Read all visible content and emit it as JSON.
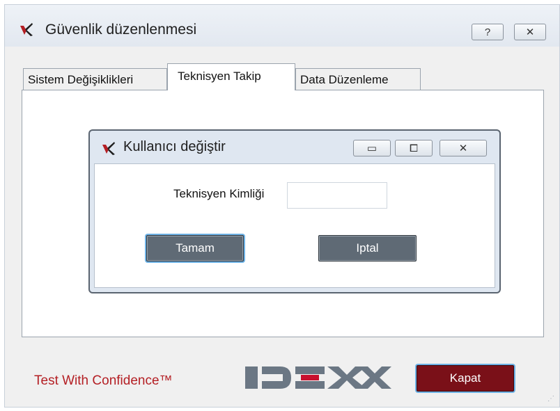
{
  "window": {
    "title": "Güvenlik düzenlenmesi",
    "help_label": "?",
    "close_label": "✕"
  },
  "tabs": [
    {
      "label": "Sistem Değişiklikleri",
      "active": false
    },
    {
      "label": "Teknisyen Takip",
      "active": true
    },
    {
      "label": "Data Düzenleme",
      "active": false
    }
  ],
  "dialog": {
    "title": "Kullanıcı değiştir",
    "minimize_label": "▭",
    "maximize_label": "⧠",
    "close_label": "✕",
    "field_label": "Teknisyen Kimliği",
    "field_value": "",
    "ok_label": "Tamam",
    "cancel_label": "Iptal"
  },
  "footer": {
    "tagline": "Test With Confidence™",
    "brand": "IDEXX",
    "close_label": "Kapat"
  },
  "colors": {
    "brand_red": "#b41f24",
    "button_gray": "#5f6a75",
    "close_button_red": "#7a1018"
  }
}
